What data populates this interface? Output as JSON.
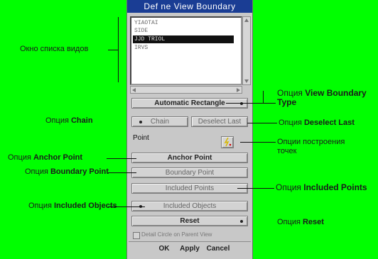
{
  "dialog": {
    "title": "Def ne View Boundary",
    "list_items": [
      "YIAOTAI",
      "SIDE",
      "JJD TRIOL",
      "IRVS"
    ],
    "selected_index": 2,
    "boundary_type_label": "Automatic Rectangle",
    "chain_label": "Chain",
    "deselect_last_label": "Deselect Last",
    "point_label": "Point",
    "anchor_point_label": "Anchor Point",
    "boundary_point_label": "Boundary Point",
    "included_points_label": "Included Points",
    "included_objects_label": "Included Objects",
    "reset_label": "Reset",
    "checkbox_label": "Detail Circle on Parent View",
    "ok_label": "OK",
    "apply_label": "Apply",
    "cancel_label": "Cancel"
  },
  "annotations": {
    "list_window": "Окно списка видов",
    "boundary_type_prefix": "Опция ",
    "boundary_type_bold": "View Boundary Type",
    "chain_prefix": "Опция ",
    "chain_bold": "Chain",
    "deselect_prefix": "Опция ",
    "deselect_bold": "Deselect Last",
    "point_options": "Опции построения точек",
    "anchor_prefix": "Опция ",
    "anchor_bold": "Anchor Point",
    "boundary_point_prefix": "Опция ",
    "boundary_point_bold": "Boundary Point",
    "included_points_prefix": "Опция ",
    "included_points_bold": "Included Points",
    "included_objects_prefix": "Опция ",
    "included_objects_bold": "Included Objects",
    "reset_prefix": "Опция ",
    "reset_bold": "Reset"
  },
  "colors": {
    "background": "#00ff00",
    "titlebar": "#1a3d94",
    "dialog": "#c8c8c8"
  }
}
